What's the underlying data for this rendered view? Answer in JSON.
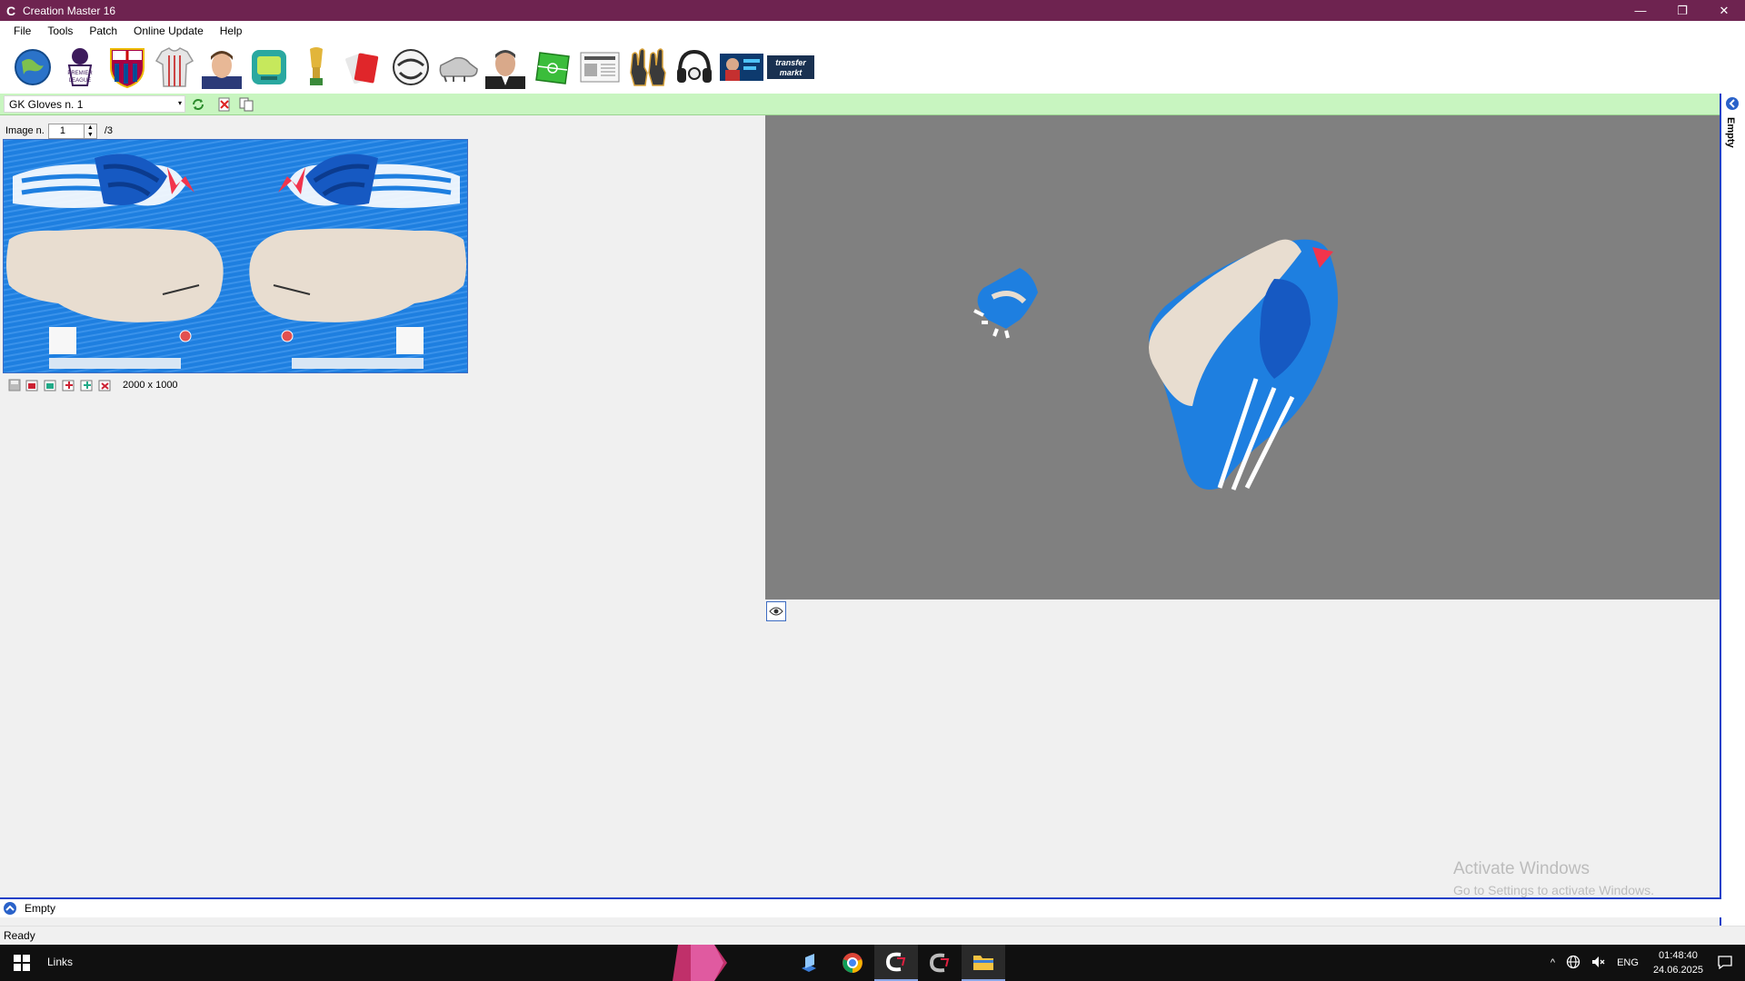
{
  "window": {
    "title": "Creation Master 16",
    "app_icon": "C",
    "minimize": "—",
    "restore": "❐",
    "close": "✕"
  },
  "menu": [
    "File",
    "Tools",
    "Patch",
    "Online Update",
    "Help"
  ],
  "toolbar_icons": [
    "globe-icon",
    "premier-league-icon",
    "club-crest-icon",
    "kit-icon",
    "player-icon",
    "tv-icon",
    "trophy-icon",
    "card-icon",
    "ball-icon",
    "boot-icon",
    "manager-icon",
    "pitch-icon",
    "newspaper-icon",
    "gk-gloves-icon",
    "headphones-icon",
    "fifa-card-icon",
    "transfermarkt-icon"
  ],
  "premier_league": "PREMIER LEAGUE",
  "transfermarkt": [
    "transfer",
    "markt"
  ],
  "selector": {
    "value": "GK Gloves n. 1",
    "arrow": "▾"
  },
  "image_nav": {
    "label": "Image n.",
    "value": "1",
    "total": "/3"
  },
  "texture": {
    "size": "2000 x 1000"
  },
  "right_panel": {
    "label": "Empty"
  },
  "empty_bar": {
    "label": "Empty"
  },
  "status": "Ready",
  "watermark": {
    "line1": "Activate Windows",
    "line2": "Go to Settings to activate Windows."
  },
  "taskbar": {
    "links": "Links",
    "lang": "ENG",
    "time": "01:48:40",
    "date": "24.06.2025",
    "tray_up": "^"
  },
  "colors": {
    "titlebar": "#6e2350",
    "accent": "#1a40c8",
    "selector_bg": "#c8f5c0",
    "viewport": "#808080",
    "glove_blue": "#1e7fe0"
  }
}
